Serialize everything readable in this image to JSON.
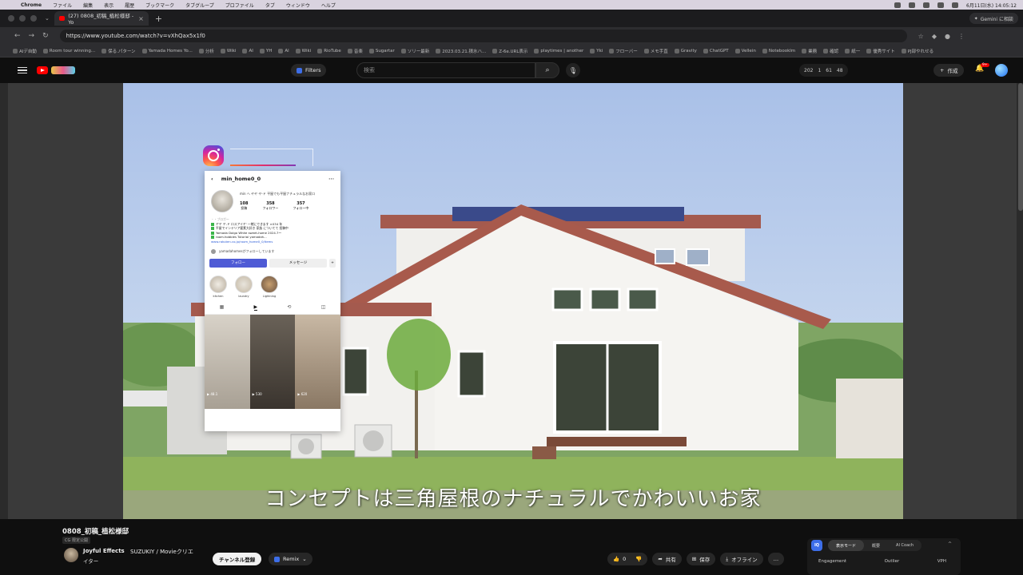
{
  "menubar": {
    "app": "Chrome",
    "items": [
      "ファイル",
      "編集",
      "表示",
      "履歴",
      "ブックマーク",
      "タブグループ",
      "プロファイル",
      "タブ",
      "ウィンドウ",
      "ヘルプ"
    ],
    "clock": "6月11日(水) 14:05:12"
  },
  "browser": {
    "tab_title": "(27) 0808_初稿_植松様邸 - Yo",
    "gemini_label": "Gemini に相談",
    "url": "https://www.youtube.com/watch?v=vXhQax5x1f0",
    "bookmarks": [
      "AIデ自動",
      "Room tour winning...",
      "保る.パターン",
      "Yamada Homes Yo...",
      "分析",
      "Wiki",
      "AI",
      "YH",
      "Al",
      "Wiki",
      "RioTube",
      "音楽",
      "Sugartar",
      "ソリー最新",
      "2023.03.21.積水ハ...",
      "Z-6e.URL表示",
      "playtimes | another",
      "Yki",
      "フローバー",
      "メモ手直",
      "Gravity",
      "ChatGPT",
      "Vellein",
      "Notebooklm",
      "業務",
      "確認",
      "紙一",
      "優秀サイト",
      "PJ部やれせる"
    ]
  },
  "youtube": {
    "filters_label": "Filters",
    "search_placeholder": "検索",
    "stats": [
      "202",
      "1",
      "61",
      "48"
    ],
    "create_label": "作成",
    "notif_count": "9+"
  },
  "instagram": {
    "username": "min_home0_0",
    "display_name": "min ヘ ヤヤ ヤ-ド 平屋でも平屋ナチュラルなお家ロ",
    "counts": [
      {
        "num": "108",
        "label": "投稿"
      },
      {
        "num": "358",
        "label": "フォロワー"
      },
      {
        "num": "357",
        "label": "フォロー中"
      }
    ],
    "bio_heading": "・・ブロガー",
    "bio": [
      "ヤヤ ヤ-ド ロスアイヤ' 一緒にできます ×034 年",
      "平屋でインテリア要素大好き 家族 についてて 投稿中",
      "Yamada Dolgo White sweet-home 2024.7～",
      "room.hobbies Tutorial yamadah..."
    ],
    "bio_link": "www.rakuten.co.jp/room_home0_0/items",
    "followed_by": "yamadahomesがフォローしています",
    "follow_btn": "フォロー",
    "message_btn": "メッセージ",
    "add_btn": "+",
    "highlights": [
      "kitchen",
      "laundry",
      "Lightning"
    ],
    "grid_views": [
      "▶ 48.1",
      "▶ 530",
      "▶ 620"
    ]
  },
  "video": {
    "subtitle": "コンセプトは三角屋根のナチュラルでかわいいお家"
  },
  "page": {
    "title": "0808_初稿_植松様邸",
    "visibility": "CG 限定公開",
    "channel_name": "Joyful Effects",
    "channel_collab": "SUZUKIY / Movieクリエ",
    "channel_collab2": "イター",
    "subscribe_label": "チャンネル登録",
    "remix_label": "Remix",
    "like_count": "0",
    "share_label": "共有",
    "save_label": "保存",
    "offline_label": "オフライン",
    "more_label": "…"
  },
  "iq": {
    "logo": "IQ",
    "tabs": [
      "表示モード",
      "概要",
      "AI Coach"
    ],
    "collapse": "^",
    "metrics": [
      "Engagement",
      "Outlier",
      "VPH"
    ]
  }
}
